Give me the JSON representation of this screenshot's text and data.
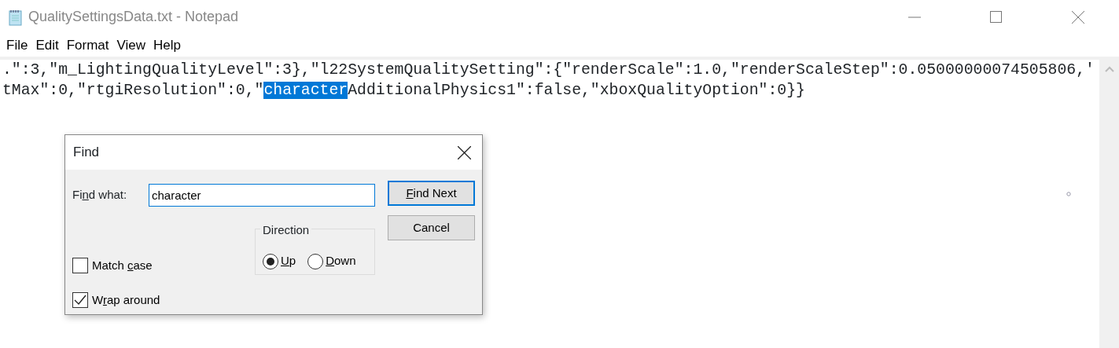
{
  "window": {
    "title": "QualitySettingsData.txt - Notepad"
  },
  "menu": [
    "File",
    "Edit",
    "Format",
    "View",
    "Help"
  ],
  "editor": {
    "lines": [
      [
        {
          "text": ".\":3,\"m_LightingQualityLevel\":3},\"l22SystemQualitySetting\":{\"renderScale\":1.0,\"renderScaleStep\":0.05000000074505806,'",
          "selected": false
        }
      ],
      [
        {
          "text": "tMax\":0,\"rtgiResolution\":0,\"",
          "selected": false
        },
        {
          "text": "character",
          "selected": true
        },
        {
          "text": "AdditionalPhysics1\":false,\"xboxQualityOption\":0}}",
          "selected": false
        }
      ]
    ]
  },
  "find_dialog": {
    "title": "Find",
    "find_what": {
      "label": [
        {
          "text": "Fi",
          "underlined": false
        },
        {
          "text": "n",
          "underlined": true
        },
        {
          "text": "d what:",
          "underlined": false
        }
      ],
      "value": "character"
    },
    "buttons": [
      {
        "label": [
          {
            "text": "F",
            "underlined": true
          },
          {
            "text": "ind Next",
            "underlined": false
          }
        ],
        "default": true
      },
      {
        "label": [
          {
            "text": "Cancel",
            "underlined": false
          }
        ],
        "default": false
      }
    ],
    "direction": {
      "label": "Direction",
      "options": [
        {
          "label": [
            {
              "text": "U",
              "underlined": true
            },
            {
              "text": "p",
              "underlined": false
            }
          ],
          "selected": true
        },
        {
          "label": [
            {
              "text": "D",
              "underlined": true
            },
            {
              "text": "own",
              "underlined": false
            }
          ],
          "selected": false
        }
      ]
    },
    "options": [
      {
        "label": [
          {
            "text": "Match ",
            "underlined": false
          },
          {
            "text": "c",
            "underlined": true
          },
          {
            "text": "ase",
            "underlined": false
          }
        ],
        "checked": false
      },
      {
        "label": [
          {
            "text": "W",
            "underlined": false
          },
          {
            "text": "r",
            "underlined": true
          },
          {
            "text": "ap around",
            "underlined": false
          }
        ],
        "checked": true
      }
    ]
  }
}
